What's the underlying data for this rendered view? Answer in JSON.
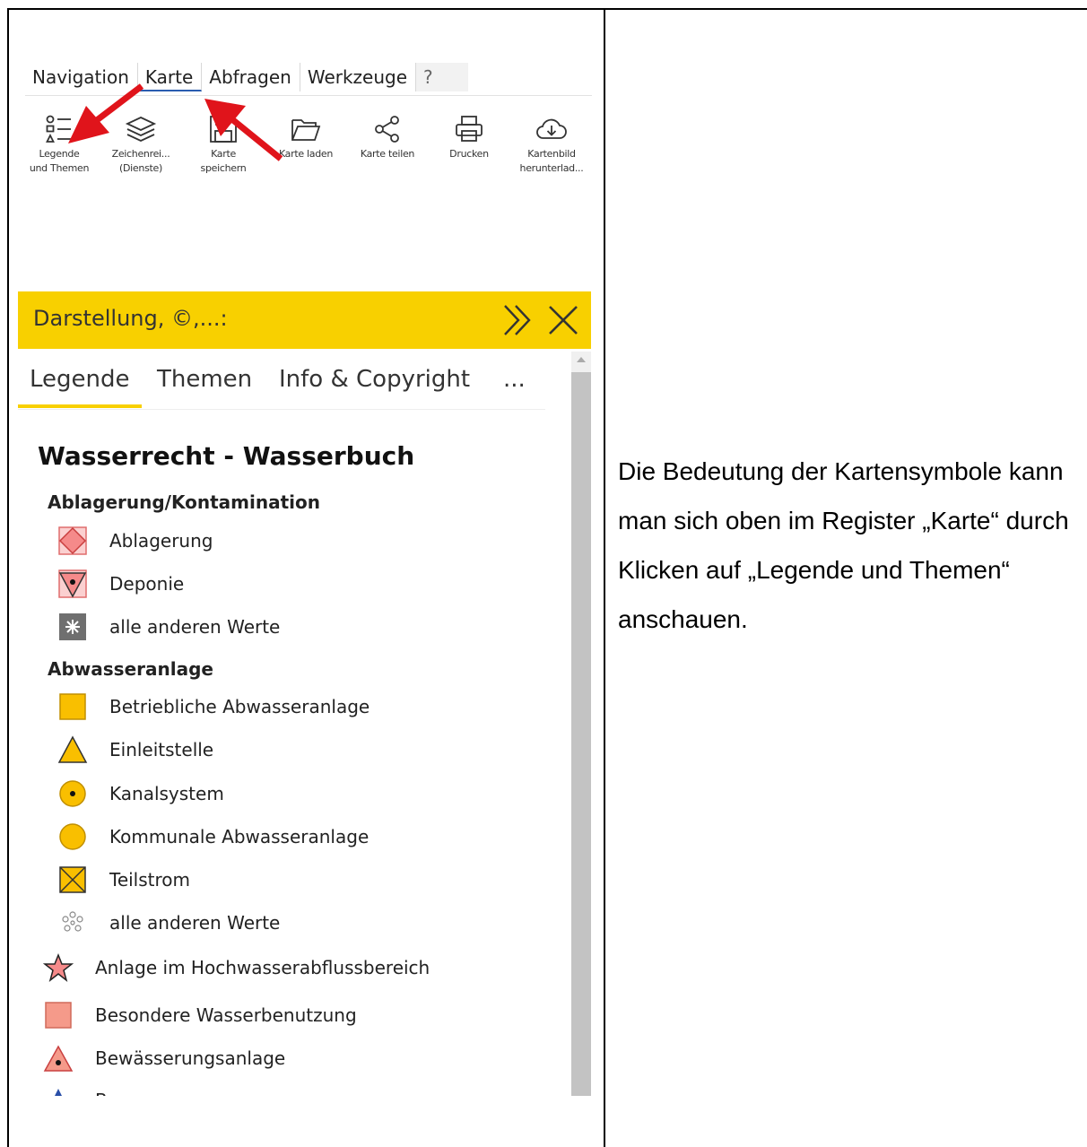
{
  "menu": {
    "tabs": [
      {
        "label": "Navigation"
      },
      {
        "label": "Karte",
        "active": true
      },
      {
        "label": "Abfragen"
      },
      {
        "label": "Werkzeuge"
      },
      {
        "label": "?"
      }
    ]
  },
  "toolbar": {
    "items": [
      {
        "label": "Legende\nund Themen",
        "icon": "legend-list-icon"
      },
      {
        "label": "Zeichenrei...\n(Dienste)",
        "icon": "layers-icon"
      },
      {
        "label": "Karte\nspeichern",
        "icon": "save-icon"
      },
      {
        "label": "Karte laden",
        "icon": "folder-open-icon"
      },
      {
        "label": "Karte teilen",
        "icon": "share-icon"
      },
      {
        "label": "Drucken",
        "icon": "printer-icon"
      },
      {
        "label": "Kartenbild\nherunterlad...",
        "icon": "cloud-download-icon"
      }
    ]
  },
  "panel": {
    "title": "Darstellung, ©,...:",
    "background": "#f8d000",
    "tabs": [
      {
        "label": "Legende",
        "active": true
      },
      {
        "label": "Themen"
      },
      {
        "label": "Info & Copyright"
      },
      {
        "label": "..."
      }
    ]
  },
  "legend": {
    "title": "Wasserrecht - Wasserbuch",
    "sections": [
      {
        "heading": "Ablagerung/Kontamination",
        "items": [
          {
            "label": "Ablagerung",
            "icon": "pink-diamond-icon"
          },
          {
            "label": "Deponie",
            "icon": "pink-triangle-dot-icon"
          },
          {
            "label": "alle anderen Werte",
            "icon": "gray-star-icon"
          }
        ]
      },
      {
        "heading": "Abwasseranlage",
        "items": [
          {
            "label": "Betriebliche Abwasseranlage",
            "icon": "orange-square-icon"
          },
          {
            "label": "Einleitstelle",
            "icon": "orange-triangle-icon"
          },
          {
            "label": "Kanalsystem",
            "icon": "orange-circle-dot-icon"
          },
          {
            "label": "Kommunale Abwasseranlage",
            "icon": "orange-circle-icon"
          },
          {
            "label": "Teilstrom",
            "icon": "orange-crossed-square-icon"
          },
          {
            "label": "alle anderen Werte",
            "icon": "outline-star-icon"
          }
        ]
      }
    ],
    "extra_items": [
      {
        "label": "Anlage im Hochwasserabflussbereich",
        "icon": "red-star-icon"
      },
      {
        "label": "Besondere Wasserbenutzung",
        "icon": "salmon-square-icon"
      },
      {
        "label": "Bewässerungsanlage",
        "icon": "salmon-triangle-dot-icon"
      },
      {
        "label": "B",
        "icon": "blue-marker-icon"
      }
    ]
  },
  "explanation": {
    "text": "Die Bedeutung der Kartensymbole kann man sich oben im Register „Karte“ durch Klicken auf „Legende und Themen“ anschauen."
  },
  "colors": {
    "accent_yellow": "#f8d000",
    "arrow_red": "#e0141b",
    "legend_orange": "#f9bf00",
    "legend_pink": "#f58a8a"
  }
}
